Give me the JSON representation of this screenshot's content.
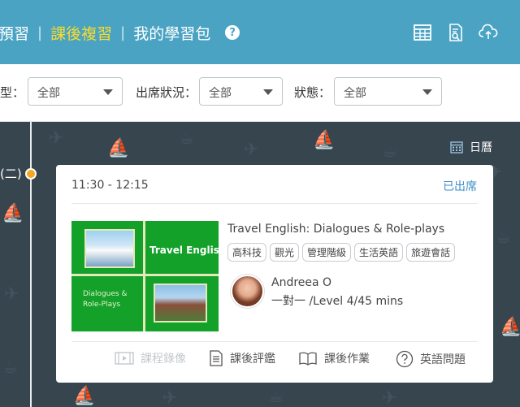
{
  "header": {
    "tabs": [
      {
        "label": "預習",
        "active": false
      },
      {
        "label": "課後複習",
        "active": true
      },
      {
        "label": "我的學習包",
        "active": false
      }
    ],
    "help_label": "?",
    "icons": [
      "table-icon",
      "document-search-icon",
      "cloud-upload-icon"
    ]
  },
  "filters": {
    "type": {
      "label": "型：",
      "value": "全部"
    },
    "attendance": {
      "label": "出席狀況：",
      "value": "全部"
    },
    "status": {
      "label": "狀態：",
      "value": "全部"
    }
  },
  "timeline": {
    "date_label": "(二)",
    "calendar_label": "日曆"
  },
  "lesson": {
    "time": "11:30 - 12:15",
    "attendance_status": "已出席",
    "thumbnail": {
      "title": "Travel English",
      "subtitle_line1": "Dialogues &",
      "subtitle_line2": "Role-Plays"
    },
    "title": "Travel English: Dialogues & Role-plays",
    "tags": [
      "高科技",
      "觀光",
      "管理階級",
      "生活英語",
      "旅遊會話"
    ],
    "teacher": {
      "name": "Andreea O",
      "info": "一對一 /Level 4/45 mins"
    },
    "actions": [
      {
        "label": "課程錄像",
        "icon": "video-icon",
        "enabled": false
      },
      {
        "label": "課後評鑑",
        "icon": "document-icon",
        "enabled": true
      },
      {
        "label": "課後作業",
        "icon": "book-icon",
        "enabled": true
      },
      {
        "label": "英語問題",
        "icon": "question-icon",
        "enabled": true
      }
    ]
  },
  "colors": {
    "header_bg": "#4aa3c3",
    "active_tab": "#f7dc2d",
    "dark_bg": "#37454f",
    "timeline_dot": "#f5a623",
    "link_blue": "#3b8fc9"
  }
}
